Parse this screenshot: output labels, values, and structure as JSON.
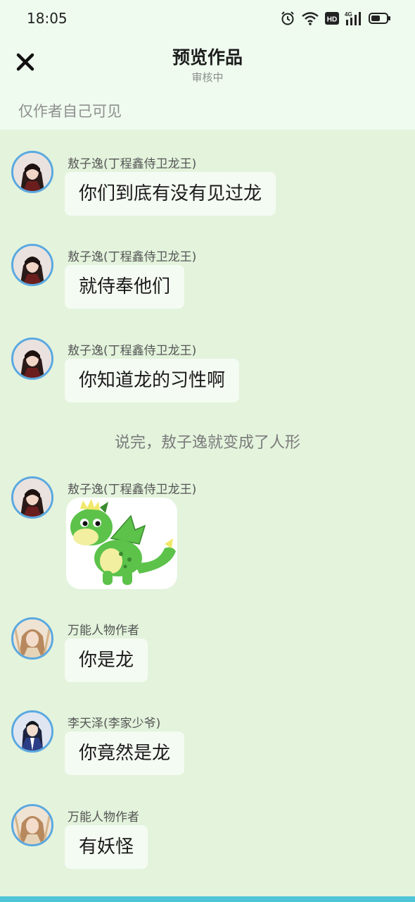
{
  "status_bar": {
    "time": "18:05",
    "icons": [
      "alarm-icon",
      "wifi-icon",
      "hd-icon",
      "signal-4g-icon",
      "battery-icon"
    ],
    "hd_label": "HD",
    "network_label": "4G"
  },
  "header": {
    "close_icon": "close-icon",
    "title": "预览作品",
    "subtitle": "审核中",
    "visibility": "仅作者自己可见"
  },
  "colors": {
    "background": "#e3f3dc",
    "header_bg": "#effbef",
    "bubble_bg": "#f4fbf2",
    "avatar_border": "#5aa8e0",
    "bottom_bar": "#4fc4d6"
  },
  "messages": [
    {
      "type": "message",
      "sender": "敖子逸(丁程鑫侍卫龙王)",
      "text": "你们到底有没有见过龙",
      "avatar": "avatar-aoziyi"
    },
    {
      "type": "message",
      "sender": "敖子逸(丁程鑫侍卫龙王)",
      "text": "就侍奉他们",
      "avatar": "avatar-aoziyi"
    },
    {
      "type": "message",
      "sender": "敖子逸(丁程鑫侍卫龙王)",
      "text": "你知道龙的习性啊",
      "avatar": "avatar-aoziyi"
    },
    {
      "type": "narration",
      "text": "说完，敖子逸就变成了人形"
    },
    {
      "type": "sticker",
      "sender": "敖子逸(丁程鑫侍卫龙王)",
      "sticker": "green-dragon-sticker",
      "avatar": "avatar-aoziyi"
    },
    {
      "type": "message",
      "sender": "万能人物作者",
      "text": "你是龙",
      "avatar": "avatar-author"
    },
    {
      "type": "message",
      "sender": "李天泽(李家少爷)",
      "text": "你竟然是龙",
      "avatar": "avatar-litianze"
    },
    {
      "type": "message",
      "sender": "万能人物作者",
      "text": "有妖怪",
      "avatar": "avatar-author"
    }
  ]
}
